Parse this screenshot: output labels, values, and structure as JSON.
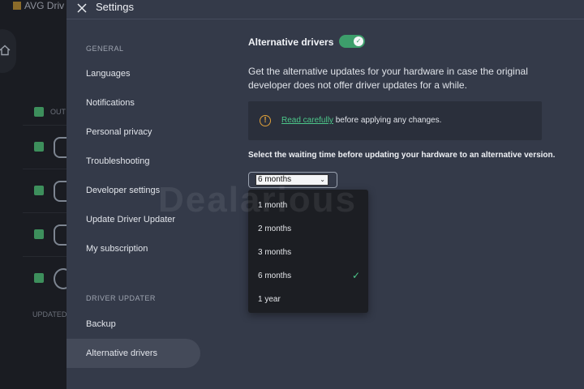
{
  "background_app": {
    "title": "AVG Driv",
    "header_col": "OUT",
    "updated_label": "UPDATED"
  },
  "modal": {
    "title": "Settings"
  },
  "sidebar": {
    "general_label": "GENERAL",
    "items": [
      {
        "label": "Languages"
      },
      {
        "label": "Notifications"
      },
      {
        "label": "Personal privacy"
      },
      {
        "label": "Troubleshooting"
      },
      {
        "label": "Developer settings"
      },
      {
        "label": "Update Driver Updater"
      },
      {
        "label": "My subscription"
      }
    ],
    "driver_updater_label": "DRIVER UPDATER",
    "driver_items": [
      {
        "label": "Backup"
      },
      {
        "label": "Alternative drivers"
      }
    ]
  },
  "content": {
    "toggle_label": "Alternative drivers",
    "toggle_on": true,
    "description": "Get the alternative updates for your hardware in case the original developer does not offer driver updates for a while.",
    "notice_link": "Read carefully",
    "notice_text": " before applying any changes.",
    "wait_label": "Select the waiting time before updating your hardware to an alternative version.",
    "selected": "6 months",
    "options": [
      "1 month",
      "2 months",
      "3 months",
      "6 months",
      "1 year"
    ]
  },
  "watermark": "Dealarious",
  "colors": {
    "accent": "#3d9e6b",
    "link": "#4cc78a",
    "warning": "#e0a13a",
    "modal_bg": "#343a49"
  }
}
